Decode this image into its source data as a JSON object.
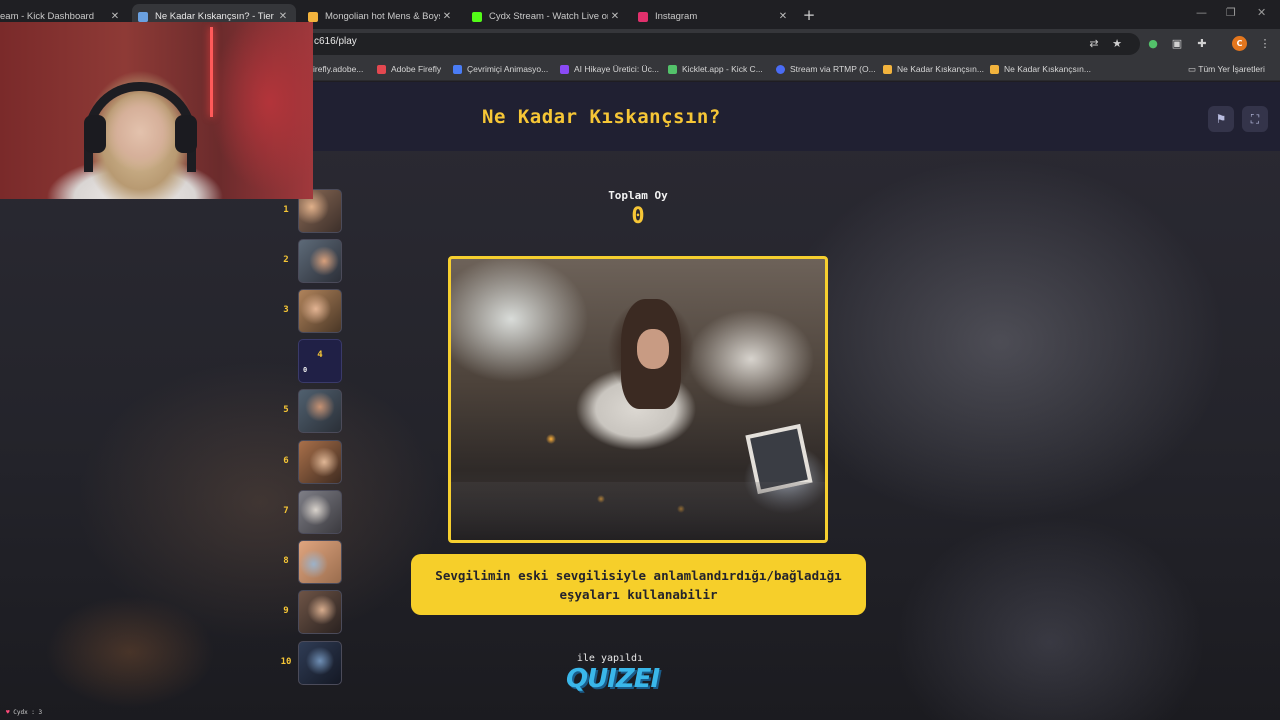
{
  "browser": {
    "tabs": [
      {
        "title": "eam - Kick Dashboard",
        "active": false,
        "favicon_color": "#53fc18"
      },
      {
        "title": "Ne Kadar Kıskançsın? - Tier List",
        "active": true,
        "favicon_color": "#6aa0e0"
      },
      {
        "title": "Mongolian hot Mens & Boys -",
        "active": false,
        "favicon_color": "#f2b33d"
      },
      {
        "title": "Cydx Stream - Watch Live on Ki",
        "active": false,
        "favicon_color": "#53fc18"
      },
      {
        "title": "Instagram",
        "active": false,
        "favicon_color": "#e1306c"
      }
    ],
    "new_tab_label": "+",
    "url": "c616/play",
    "profile_initial": "C",
    "bookmarks": [
      {
        "label": "irefly.adobe...",
        "color": "#6b6b6b"
      },
      {
        "label": "Adobe Firefly",
        "color": "#e34850"
      },
      {
        "label": "Çevrimiçi Animasyo...",
        "color": "#4a7cf5"
      },
      {
        "label": "AI Hikaye Üretici: Üc...",
        "color": "#8a4af5"
      },
      {
        "label": "Kicklet.app - Kick C...",
        "color": "#53c26a"
      },
      {
        "label": "Stream via RTMP (O...",
        "color": "#4a6cf5"
      },
      {
        "label": "Ne Kadar Kıskançsın...",
        "color": "#f2b33d"
      },
      {
        "label": "Ne Kadar Kıskançsın...",
        "color": "#f2b33d"
      }
    ],
    "all_bookmarks_label": "Tüm Yer İşaretleri"
  },
  "quiz": {
    "title": "Ne Kadar Kıskançsın?",
    "vote_label": "Toplam Oy",
    "vote_count": "0",
    "caption": "Sevgilimin eski sevgilisiyle anlamlandırdığı/bağladığı eşyaları kullanabilir",
    "made_with": "ile yapıldı",
    "brand": "QUIZEI",
    "current_rank": "4",
    "current_votes": "0",
    "ranks": [
      "1",
      "2",
      "3",
      "4",
      "5",
      "6",
      "7",
      "8",
      "9",
      "10"
    ]
  },
  "chat_status": {
    "user": "Cydx",
    "count": "3"
  }
}
